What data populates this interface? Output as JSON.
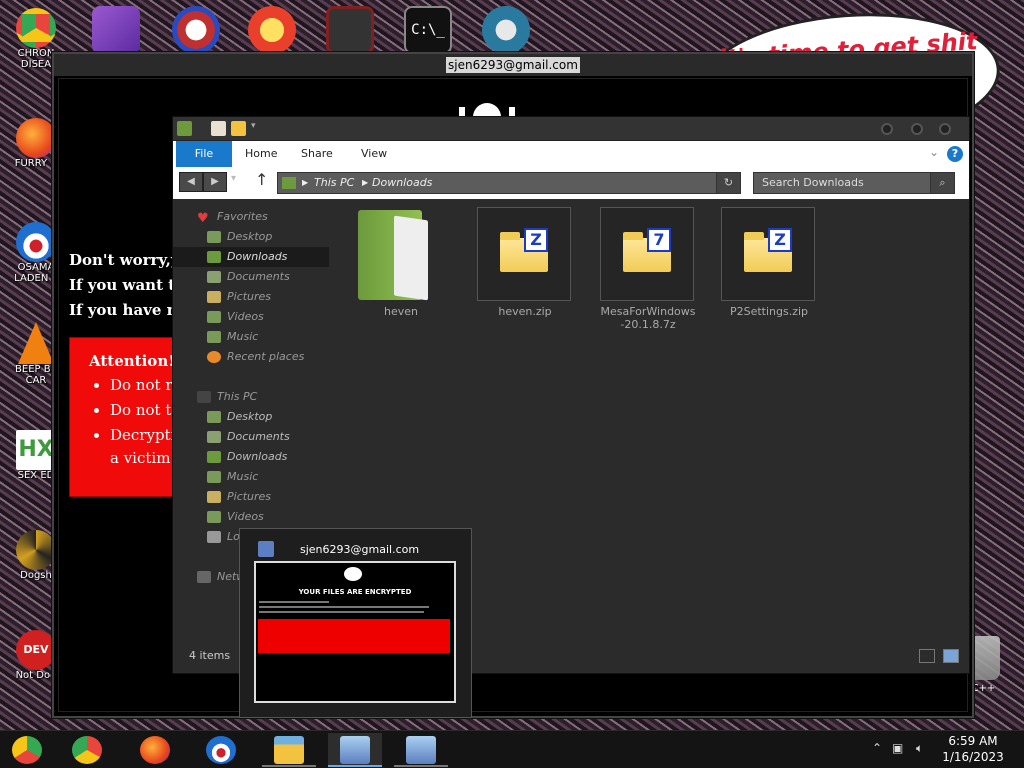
{
  "desktop": {
    "wallpaper_text": "it's time to get shit",
    "wallpaper_text_2": "te",
    "left_icons": [
      {
        "label": "CHRON\nDISEA",
        "icon": "chrome-icon",
        "color": "#e8453c"
      },
      {
        "label": "FURRY C",
        "icon": "firefox-icon",
        "color": "#ff7b1c"
      },
      {
        "label": "OSAMA\nLADEN E",
        "icon": "obama-logo-icon",
        "color": "#1e6fd0"
      },
      {
        "label": "BEEP BE\nCAR",
        "icon": "vlc-cone-icon",
        "color": "#f08010"
      },
      {
        "label": "SEX ED",
        "icon": "hx-icon",
        "color": "#3f9a3f"
      },
      {
        "label": "Dogsh",
        "icon": "swirl-icon",
        "color": "#d4a020"
      },
      {
        "label": "Not Dog",
        "icon": "dev-cpp-icon",
        "color": "#d02020"
      }
    ],
    "top_icons": [
      {
        "icon": "visual-studio-icon",
        "color": "#7a3fc0"
      },
      {
        "icon": "number-2-icon",
        "color": "#c03030"
      },
      {
        "icon": "p-badge-icon",
        "color": "#e8402a"
      },
      {
        "icon": "red-logo-icon",
        "color": "#802020"
      },
      {
        "icon": "cmd-prompt-icon",
        "color": "#202020"
      },
      {
        "icon": "santa-ball-icon",
        "color": "#2a7aa0"
      }
    ],
    "recycle_label": "n C++"
  },
  "ransom_window": {
    "title": "sjen6293@gmail.com",
    "lines": [
      "Don't worry,yo",
      "If you want to",
      "If you have no"
    ],
    "attention": {
      "heading": "Attention!",
      "items": [
        "Do not r",
        "Do not t",
        "Decryptio"
      ],
      "continuation": "a victim"
    }
  },
  "explorer": {
    "ribbon": {
      "file": "File",
      "tabs": [
        "Home",
        "Share",
        "View"
      ],
      "help": "?"
    },
    "address": {
      "segments": [
        "This PC",
        "Downloads"
      ]
    },
    "search_placeholder": "Search Downloads",
    "nav": {
      "favorites_label": "Favorites",
      "favorites": [
        "Desktop",
        "Downloads",
        "Documents",
        "Pictures",
        "Videos",
        "Music",
        "Recent places"
      ],
      "thispc_label": "This PC",
      "thispc": [
        "Desktop",
        "Documents",
        "Downloads",
        "Music",
        "Pictures",
        "Videos",
        "Lo"
      ],
      "network_label": "Netw"
    },
    "files": [
      {
        "name": "heven",
        "type": "folder"
      },
      {
        "name": "heven.zip",
        "type": "zip",
        "badge": "Z"
      },
      {
        "name": "MesaForWindows-20.1.8.7z",
        "type": "7z",
        "badge": "7"
      },
      {
        "name": "P2Settings.zip",
        "type": "zip",
        "badge": "Z"
      }
    ],
    "status": "4 items"
  },
  "thumbnail": {
    "title": "sjen6293@gmail.com",
    "preview_heading": "YOUR FILES ARE ENCRYPTED"
  },
  "taskbar": {
    "apps": [
      {
        "icon": "chrome-disease-icon",
        "color": "#3f9a3f"
      },
      {
        "icon": "chrome-icon",
        "color": "#e8453c"
      },
      {
        "icon": "firefox-icon",
        "color": "#ff7b1c"
      },
      {
        "icon": "obama-logo-icon",
        "color": "#1e6fd0"
      },
      {
        "icon": "file-explorer-icon",
        "color": "#f3c23f"
      },
      {
        "icon": "ransomware-app-icon",
        "color": "#5b7fc0"
      },
      {
        "icon": "ransomware-app-icon-2",
        "color": "#5b7fc0"
      }
    ],
    "time": "6:59 AM",
    "date": "1/16/2023"
  }
}
